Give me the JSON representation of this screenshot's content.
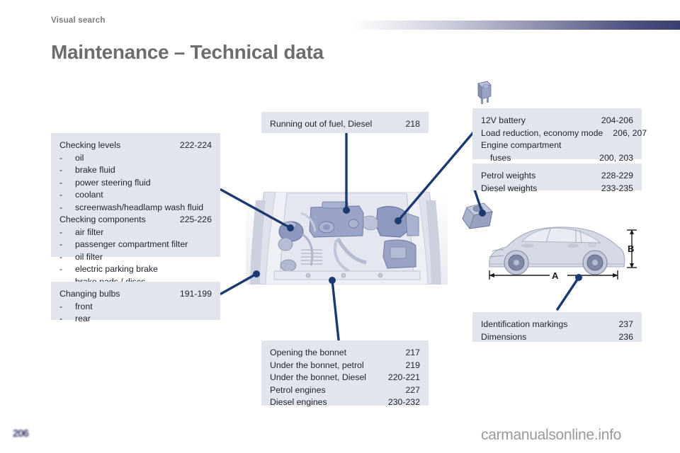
{
  "header": {
    "eyebrow": "Visual search",
    "title": "Maintenance – Technical data"
  },
  "panels": {
    "checking": {
      "name": "checking-levels-panel",
      "rows": [
        {
          "label": "Checking levels",
          "pages": "222-224"
        },
        {
          "label": "oil",
          "bullet": "-"
        },
        {
          "label": "brake fluid",
          "bullet": "-"
        },
        {
          "label": "power steering fluid",
          "bullet": "-"
        },
        {
          "label": "coolant",
          "bullet": "-"
        },
        {
          "label": "screenwash/headlamp wash fluid",
          "bullet": "-"
        },
        {
          "label": "Checking components",
          "pages": "225-226"
        },
        {
          "label": "air filter",
          "bullet": "-"
        },
        {
          "label": "passenger compartment filter",
          "bullet": "-"
        },
        {
          "label": "oil filter",
          "bullet": "-"
        },
        {
          "label": "electric parking brake",
          "bullet": "-"
        },
        {
          "label": "brake pads / discs",
          "bullet": "-"
        }
      ]
    },
    "bulbs": {
      "name": "changing-bulbs-panel",
      "rows": [
        {
          "label": "Changing bulbs",
          "pages": "191-199"
        },
        {
          "label": "front",
          "bullet": "-"
        },
        {
          "label": "rear",
          "bullet": "-"
        }
      ]
    },
    "fuel": {
      "name": "running-out-of-fuel-panel",
      "rows": [
        {
          "label": "Running out of fuel, Diesel",
          "pages": "218"
        }
      ]
    },
    "bonnet": {
      "name": "bonnet-engines-panel",
      "rows": [
        {
          "label": "Opening the bonnet",
          "pages": "217"
        },
        {
          "label": "Under the bonnet, petrol",
          "pages": "219"
        },
        {
          "label": "Under the bonnet, Diesel",
          "pages": "220-221"
        },
        {
          "label": "Petrol engines",
          "pages": "227"
        },
        {
          "label": "Diesel engines",
          "pages": "230-232"
        }
      ]
    },
    "battery": {
      "name": "battery-fuses-panel",
      "rows": [
        {
          "label": "12V battery",
          "pages": "204-206"
        },
        {
          "label": "Load reduction, economy mode",
          "pages": "206, 207"
        },
        {
          "label": "Engine compartment",
          "pages": ""
        },
        {
          "label": "fuses",
          "pages": "200, 203",
          "indent": true
        }
      ]
    },
    "weights": {
      "name": "weights-panel",
      "rows": [
        {
          "label": "Petrol weights",
          "pages": "228-229"
        },
        {
          "label": "Diesel weights",
          "pages": "233-235"
        }
      ]
    },
    "identification": {
      "name": "identification-dimensions-panel",
      "rows": [
        {
          "label": "Identification markings",
          "pages": "237"
        },
        {
          "label": "Dimensions",
          "pages": "236"
        }
      ]
    }
  },
  "figures": {
    "fuse_icon": {
      "name": "fuse-icon"
    },
    "engine_bay": {
      "name": "engine-bay-illustration"
    },
    "car_dimensions": {
      "name": "car-dimensions-illustration",
      "labels": {
        "length": "A",
        "height": "B"
      }
    }
  },
  "footer": {
    "page_number": "206",
    "watermark": "carmanualsonline.info"
  },
  "colors": {
    "panel_bg": "#e2e5ee",
    "leader": "#1b3a72",
    "title": "#6d6d6d",
    "eyebrow": "#7a7a7a",
    "accent_dark": "#3b3f6e"
  }
}
